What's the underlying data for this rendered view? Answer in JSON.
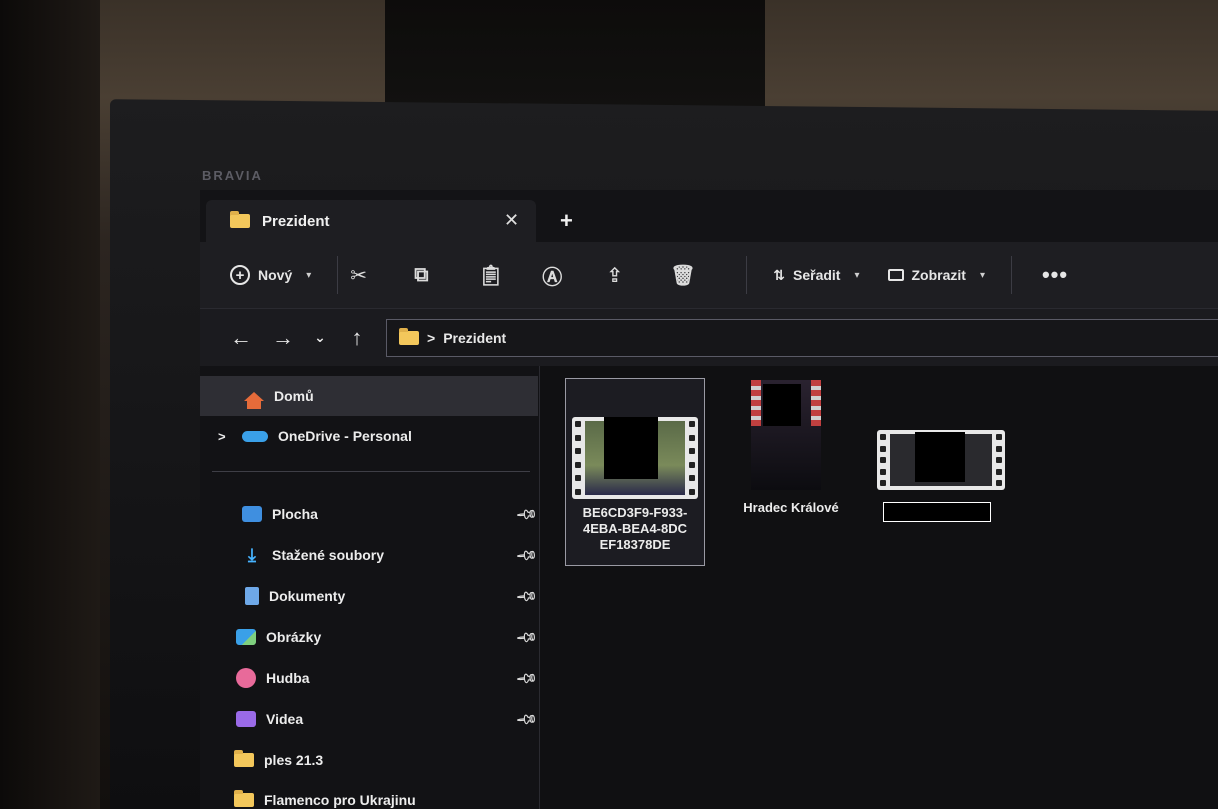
{
  "monitor": {
    "brand": "BRAVIA"
  },
  "tab": {
    "title": "Prezident",
    "close_label": "✕",
    "new_label": "+"
  },
  "toolbar": {
    "new_label": "Nový",
    "sort_label": "Seřadit",
    "view_label": "Zobrazit",
    "more_label": "•••",
    "icons": [
      "cut-icon",
      "copy-icon",
      "paste-icon",
      "rename-icon",
      "share-icon",
      "delete-icon"
    ]
  },
  "nav": {
    "back": "←",
    "forward": "→",
    "recent": "⌄",
    "up": "↑"
  },
  "address": {
    "separator": ">",
    "folder": "Prezident"
  },
  "sidebar": {
    "home": "Domů",
    "onedrive": "OneDrive - Personal",
    "expand": ">",
    "pinned": [
      "Plocha",
      "Stažené soubory",
      "Dokumenty",
      "Obrázky",
      "Hudba",
      "Videa"
    ],
    "folders": [
      "ples 21.3",
      "Flamenco pro Ukrajinu"
    ]
  },
  "files": [
    {
      "name_lines": [
        "BE6CD3F9-F933-",
        "4EBA-BEA4-8DC",
        "EF18378DE"
      ],
      "type": "video"
    },
    {
      "name_lines": [
        "Hradec Králové"
      ],
      "type": "image"
    },
    {
      "name_lines": [
        ""
      ],
      "type": "video"
    }
  ],
  "colors": {
    "folder": "#f3c75b",
    "accent": "#3aa0e8",
    "home": "#e56b3a"
  }
}
